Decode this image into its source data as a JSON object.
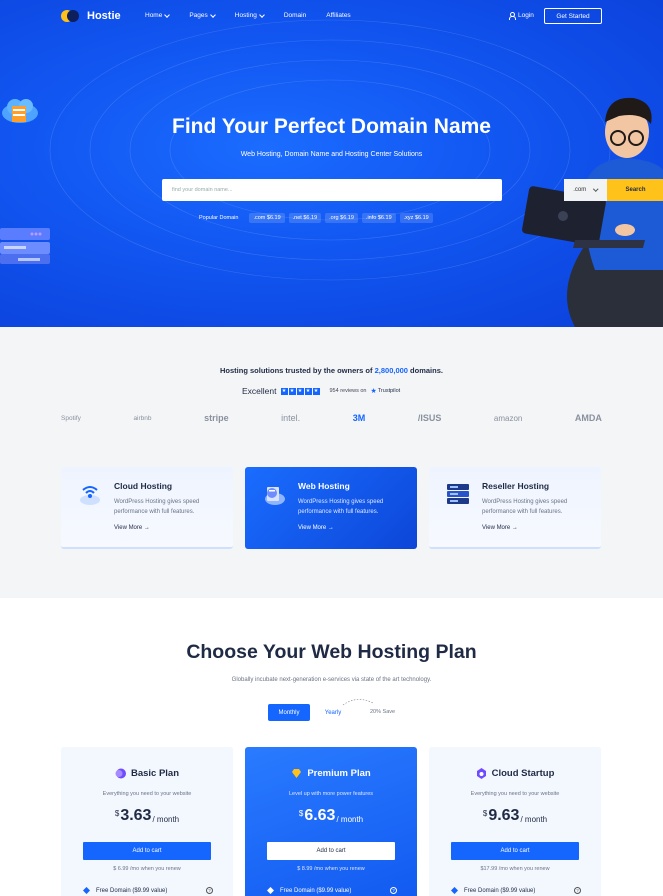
{
  "nav": {
    "brand": "Hostie",
    "links": [
      {
        "label": "Home",
        "dropdown": true
      },
      {
        "label": "Pages",
        "dropdown": true
      },
      {
        "label": "Hosting",
        "dropdown": true
      },
      {
        "label": "Domain",
        "dropdown": false
      },
      {
        "label": "Affiliates",
        "dropdown": false
      }
    ],
    "login": "Login",
    "cta": "Get Started"
  },
  "hero": {
    "title": "Find Your Perfect Domain Name",
    "subtitle": "Web Hosting, Domain Name and Hosting Center Solutions",
    "search_placeholder": "find your domain name...",
    "tld": ".com",
    "search_button": "Search",
    "popular_label": "Popular Domain",
    "popular": [
      {
        "tld": ".com",
        "price": "$6.19"
      },
      {
        "tld": ".net",
        "price": "$6.19"
      },
      {
        "tld": ".org",
        "price": "$6.19"
      },
      {
        "tld": ".info",
        "price": "$6.19"
      },
      {
        "tld": ".xyz",
        "price": "$6.19"
      }
    ]
  },
  "trust": {
    "prefix": "Hosting solutions trusted by the owners of ",
    "count": "2,800,000",
    "suffix": " domains.",
    "rating_label": "Excellent",
    "reviews": "954 reviews on",
    "trustpilot": "Trustpilot",
    "brands": [
      "Spotify",
      "airbnb",
      "stripe",
      "intel.",
      "3M",
      "/ISUS",
      "amazon",
      "AMDA"
    ]
  },
  "services": [
    {
      "title": "Cloud Hosting",
      "desc": "WordPress Hosting gives speed performance with full features.",
      "more": "View More →"
    },
    {
      "title": "Web Hosting",
      "desc": "WordPress Hosting gives speed performance with full features.",
      "more": "View More →"
    },
    {
      "title": "Reseller Hosting",
      "desc": "WordPress Hosting gives speed performance with full features.",
      "more": "View More →"
    }
  ],
  "pricing": {
    "title": "Choose Your Web Hosting Plan",
    "subtitle": "Globally incubate next-generation e-services via state of the art technology.",
    "monthly": "Monthly",
    "yearly": "Yearly",
    "save": "20% Save",
    "plans": [
      {
        "name": "Basic Plan",
        "desc": "Everything you need to your website",
        "currency": "$",
        "amount": "3.63",
        "per": "/ month",
        "button": "Add to cart",
        "renew": "$ 6.99 /mo when you renew",
        "feature": "Free Domain ($9.99 value)"
      },
      {
        "name": "Premium Plan",
        "desc": "Level up with more power features",
        "currency": "$",
        "amount": "6.63",
        "per": "/ month",
        "button": "Add to cart",
        "renew": "$ 8.99 /mo when you renew",
        "feature": "Free Domain ($9.99 value)"
      },
      {
        "name": "Cloud Startup",
        "desc": "Everything you need to your website",
        "currency": "$",
        "amount": "9.63",
        "per": "/ month",
        "button": "Add to cart",
        "renew": "$17.99 /mo when you renew",
        "feature": "Free Domain ($9.99 value)"
      }
    ]
  },
  "colors": {
    "primary": "#1565ff",
    "accent": "#ffc21a",
    "dark": "#1f2a44"
  }
}
